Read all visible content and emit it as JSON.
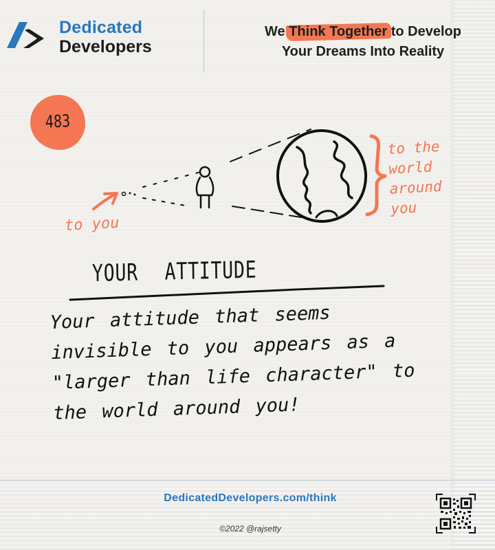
{
  "header": {
    "brand_line1": "Dedicated",
    "brand_line2": "Developers",
    "tagline_before": "We",
    "tagline_highlight": "Think Together",
    "tagline_after": "to Develop",
    "tagline_line2": "Your Dreams Into Reality"
  },
  "badge": {
    "number": "483"
  },
  "illustration": {
    "right_note": [
      "to the",
      "world",
      "around",
      "you"
    ],
    "left_note": "to you"
  },
  "content": {
    "title": "YOUR ATTITUDE",
    "body": "Your attitude that seems invisible to you appears as a \"larger than life character\" to the world around you!"
  },
  "footer": {
    "url": "DedicatedDevelopers.com/think",
    "copyright": "©2022 @rajsetty"
  },
  "colors": {
    "brand_blue": "#2a77be",
    "accent_orange": "#f47652",
    "ink": "#111111",
    "paper": "#f2f1ee"
  }
}
